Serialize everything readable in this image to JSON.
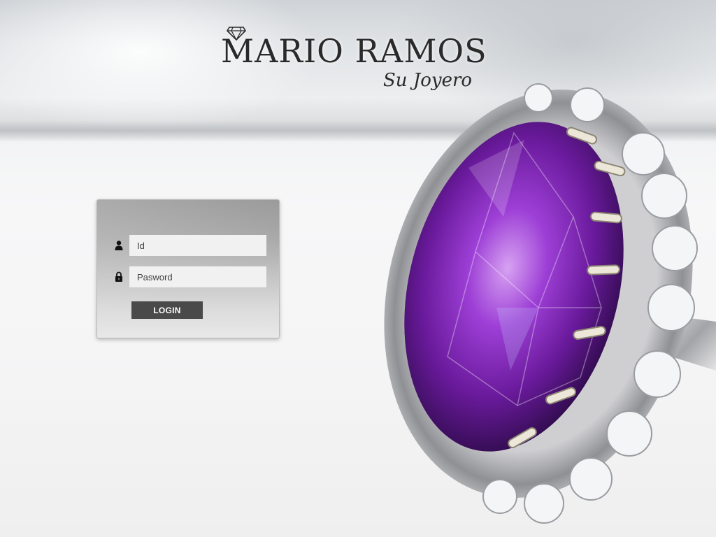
{
  "brand": {
    "name": "MARIO RAMOS",
    "tagline": "Su Joyero",
    "logo_icon": "diamond-icon"
  },
  "login": {
    "id_placeholder": "Id",
    "password_placeholder": "Pasword",
    "button_label": "LOGIN",
    "id_icon": "user-icon",
    "password_icon": "lock-icon"
  },
  "background": {
    "subject": "amethyst-diamond-ring-photo"
  },
  "colors": {
    "button": "#4a4a4a",
    "input_bg": "#f1f1f1",
    "amethyst": "#7a2bb0"
  }
}
